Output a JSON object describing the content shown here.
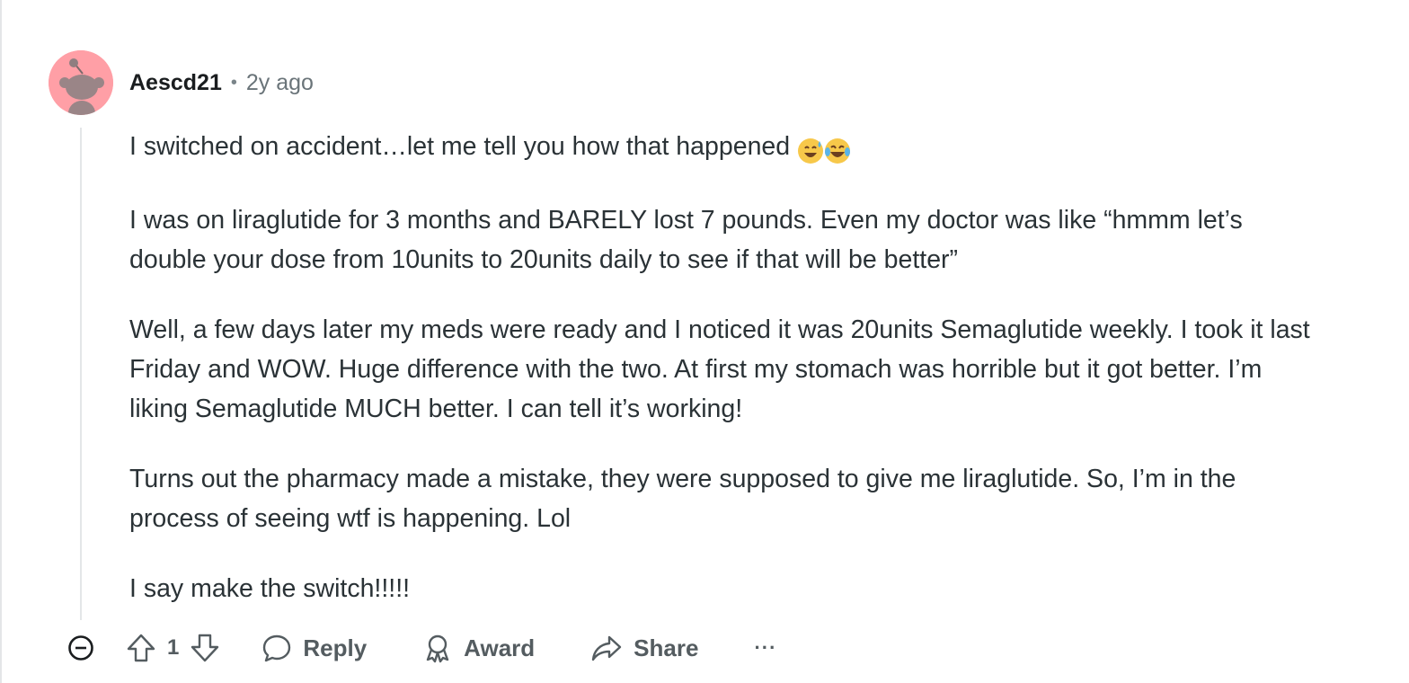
{
  "comment": {
    "username": "Aescd21",
    "separator": "•",
    "timestamp": "2y ago",
    "avatar_icon": "snoo-avatar-icon",
    "avatar_color": "#ff9fa6",
    "paragraphs": [
      "I switched on accident…let me tell you how that happened",
      "I was on liraglutide for 3 months and BARELY lost 7 pounds. Even my doctor was like “hmmm let’s double your dose from 10units to 20units daily to see if that will be better”",
      "Well, a few days later my meds were ready and I noticed it was 20units Semaglutide weekly. I took it last Friday and WOW. Huge difference with the two. At first my stomach was horrible but it got better. I’m liking Semaglutide MUCH better. I can tell it’s working!",
      "Turns out the pharmacy made a mistake, they were supposed to give me liraglutide. So, I’m in the process of seeing wtf is happening. Lol",
      "I say make the switch!!!!!"
    ],
    "emojis": [
      "grinning-sweat-emoji",
      "tears-of-joy-emoji"
    ]
  },
  "actions": {
    "collapse_icon": "minus-circle-icon",
    "vote_count": "1",
    "reply_label": "Reply",
    "award_label": "Award",
    "share_label": "Share",
    "more_label": "···"
  }
}
